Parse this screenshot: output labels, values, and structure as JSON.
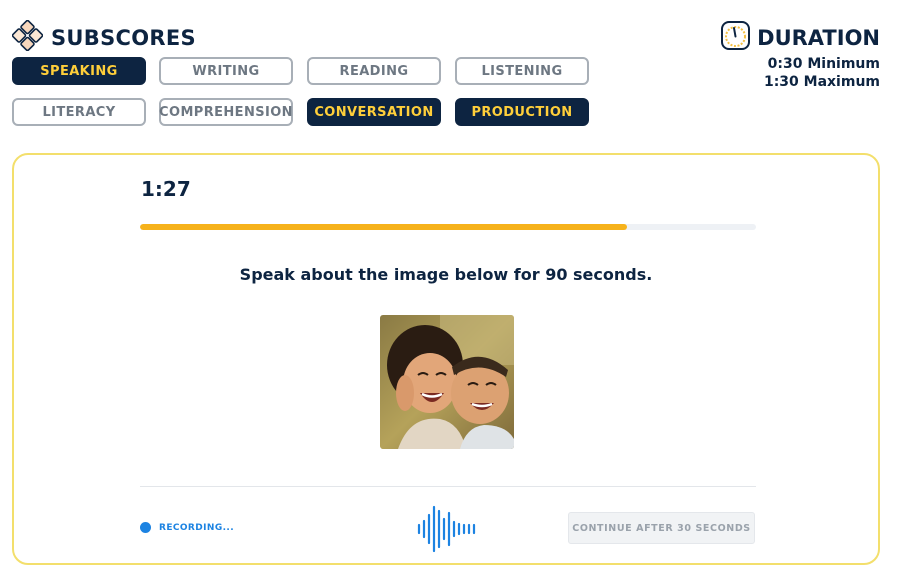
{
  "subscores": {
    "title": "SUBSCORES",
    "icon": "subscores-diamond-icon",
    "chips": [
      {
        "label": "SPEAKING",
        "active": true
      },
      {
        "label": "WRITING",
        "active": false
      },
      {
        "label": "READING",
        "active": false
      },
      {
        "label": "LISTENING",
        "active": false
      },
      {
        "label": "LITERACY",
        "active": false
      },
      {
        "label": "COMPREHENSION",
        "active": false
      },
      {
        "label": "CONVERSATION",
        "active": true
      },
      {
        "label": "PRODUCTION",
        "active": true
      }
    ]
  },
  "duration": {
    "title": "DURATION",
    "icon": "stopwatch-icon",
    "minimum": "0:30 Minimum",
    "maximum": "1:30 Maximum"
  },
  "task": {
    "timer": "1:27",
    "progress_fraction": 0.79,
    "prompt": "Speak about the image below for 90 seconds.",
    "image": "photo of two smiling children"
  },
  "footer": {
    "recording_label": "RECORDING...",
    "continue_label": "CONTINUE AFTER 30 SECONDS"
  },
  "colors": {
    "navy": "#0d2441",
    "accent_yellow": "#ffcf3a",
    "progress": "#f6b21b",
    "recording_blue": "#1c83e2",
    "panel_border": "#f3df6c"
  }
}
